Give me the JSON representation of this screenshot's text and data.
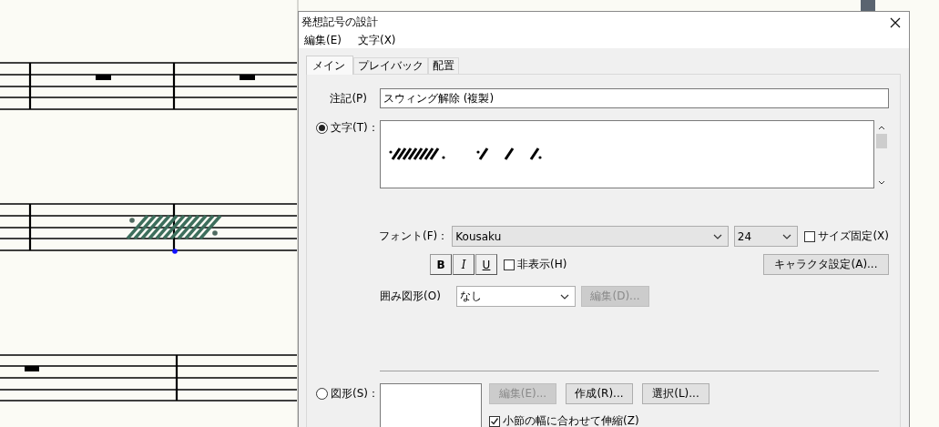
{
  "dialog": {
    "title": "発想記号の設計",
    "menu": [
      "編集(E)",
      "文字(X)"
    ],
    "tabs": [
      {
        "label": "メイン",
        "selected": true
      },
      {
        "label": "プレイバック",
        "selected": false
      },
      {
        "label": "配置",
        "selected": false
      }
    ],
    "annotation": {
      "label": "注記(P)",
      "value": "スウィング解除 (複製)"
    },
    "text_option": {
      "label": "文字(T)：",
      "selected": true
    },
    "font": {
      "label": "フォント(F)：",
      "value": "Kousaku"
    },
    "size": {
      "value": "24"
    },
    "fixed_size": {
      "label": "サイズ固定(X)",
      "checked": false
    },
    "style_buttons": [
      {
        "label": "B",
        "kind": "bold"
      },
      {
        "label": "I",
        "kind": "italic"
      },
      {
        "label": "U",
        "kind": "underline"
      }
    ],
    "hidden": {
      "label": "非表示(H)",
      "checked": false
    },
    "character_button": "キャラクタ設定(A)...",
    "enclosure": {
      "label": "囲み図形(O)",
      "value": "なし"
    },
    "enclosure_edit": {
      "label": "編集(D)...",
      "disabled": true
    },
    "shape_option": {
      "label": "図形(S)：",
      "selected": false
    },
    "shape_buttons": [
      {
        "label": "編集(E)...",
        "disabled": true
      },
      {
        "label": "作成(R)...",
        "disabled": false
      },
      {
        "label": "選択(L)...",
        "disabled": false
      }
    ],
    "fit_measure": {
      "label": "小節の幅に合わせて伸縮(Z)",
      "checked": true
    }
  }
}
